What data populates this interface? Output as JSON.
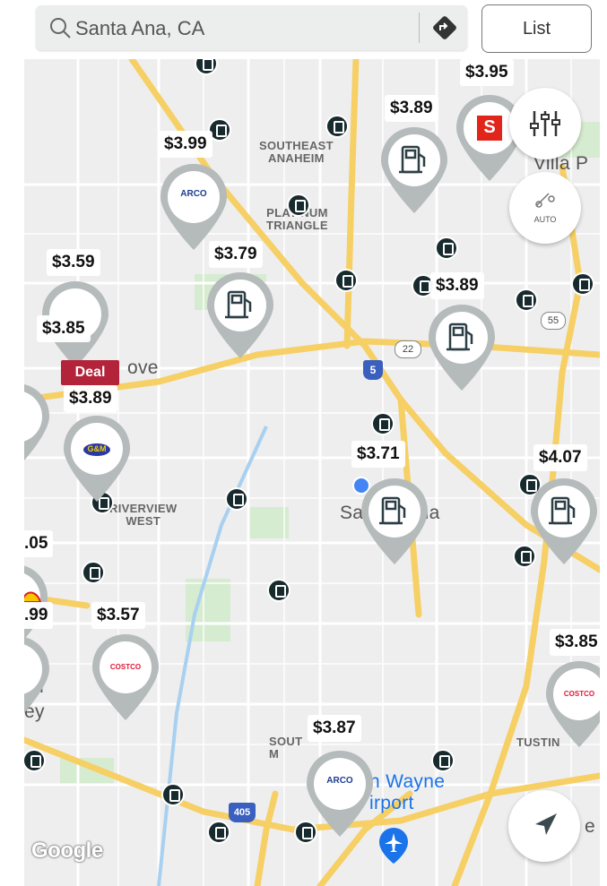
{
  "search": {
    "value": "Santa Ana, CA"
  },
  "list_button": "List",
  "price_pins": [
    {
      "price": "$3.95"
    },
    {
      "price": "$3.89"
    },
    {
      "price": "$3.99"
    },
    {
      "price": "$3.79"
    },
    {
      "price": "$3.59"
    },
    {
      "price": "$3.85"
    },
    {
      "price": "$3.89"
    },
    {
      "price": "$3.89"
    },
    {
      "price": "$3.71"
    },
    {
      "price": "$4.07"
    },
    {
      "price": ".05"
    },
    {
      "price": ".99"
    },
    {
      "price": "$3.57"
    },
    {
      "price": "$3.85"
    },
    {
      "price": "$3.87"
    }
  ],
  "deal_badge": "Deal",
  "brands": {
    "arco": "ARCO",
    "costco": "COSTCO",
    "gm": "G&M",
    "speedway": "S"
  },
  "map_labels": {
    "southeast_anaheim": "SOUTHEAST\nANAHEIM",
    "platinum_triangle": "PLATINUM\nTRIANGLE",
    "villa_park": "Villa P",
    "riverview_west": "RIVERVIEW\nWEST",
    "santa_ana": "Sa          na",
    "john_wayne": "n Wayne\nirport",
    "tustin": "TUSTIN",
    "south": "SOUT\nM",
    "grove": "ove",
    "ey": "ey",
    "n": "n",
    "e": "e"
  },
  "shields": {
    "i5": "5",
    "r22": "22",
    "r55": "55",
    "i405": "405"
  },
  "auto_label": "AUTO",
  "google_logo": "Google",
  "icons": {
    "search": "search-icon",
    "directions": "directions-icon",
    "filter": "filter-sliders-icon",
    "auto": "auto-icon",
    "locate": "navigation-arrow-icon",
    "pump": "gas-pump-icon",
    "airport": "airport-icon"
  },
  "colors": {
    "road_major": "#f6cf65",
    "road_minor": "#ffffff",
    "map_bg": "#eeeeee",
    "pin_ring": "#b5babb",
    "dot": "#172a2e",
    "deal": "#b3243a",
    "location": "#4285f4"
  }
}
